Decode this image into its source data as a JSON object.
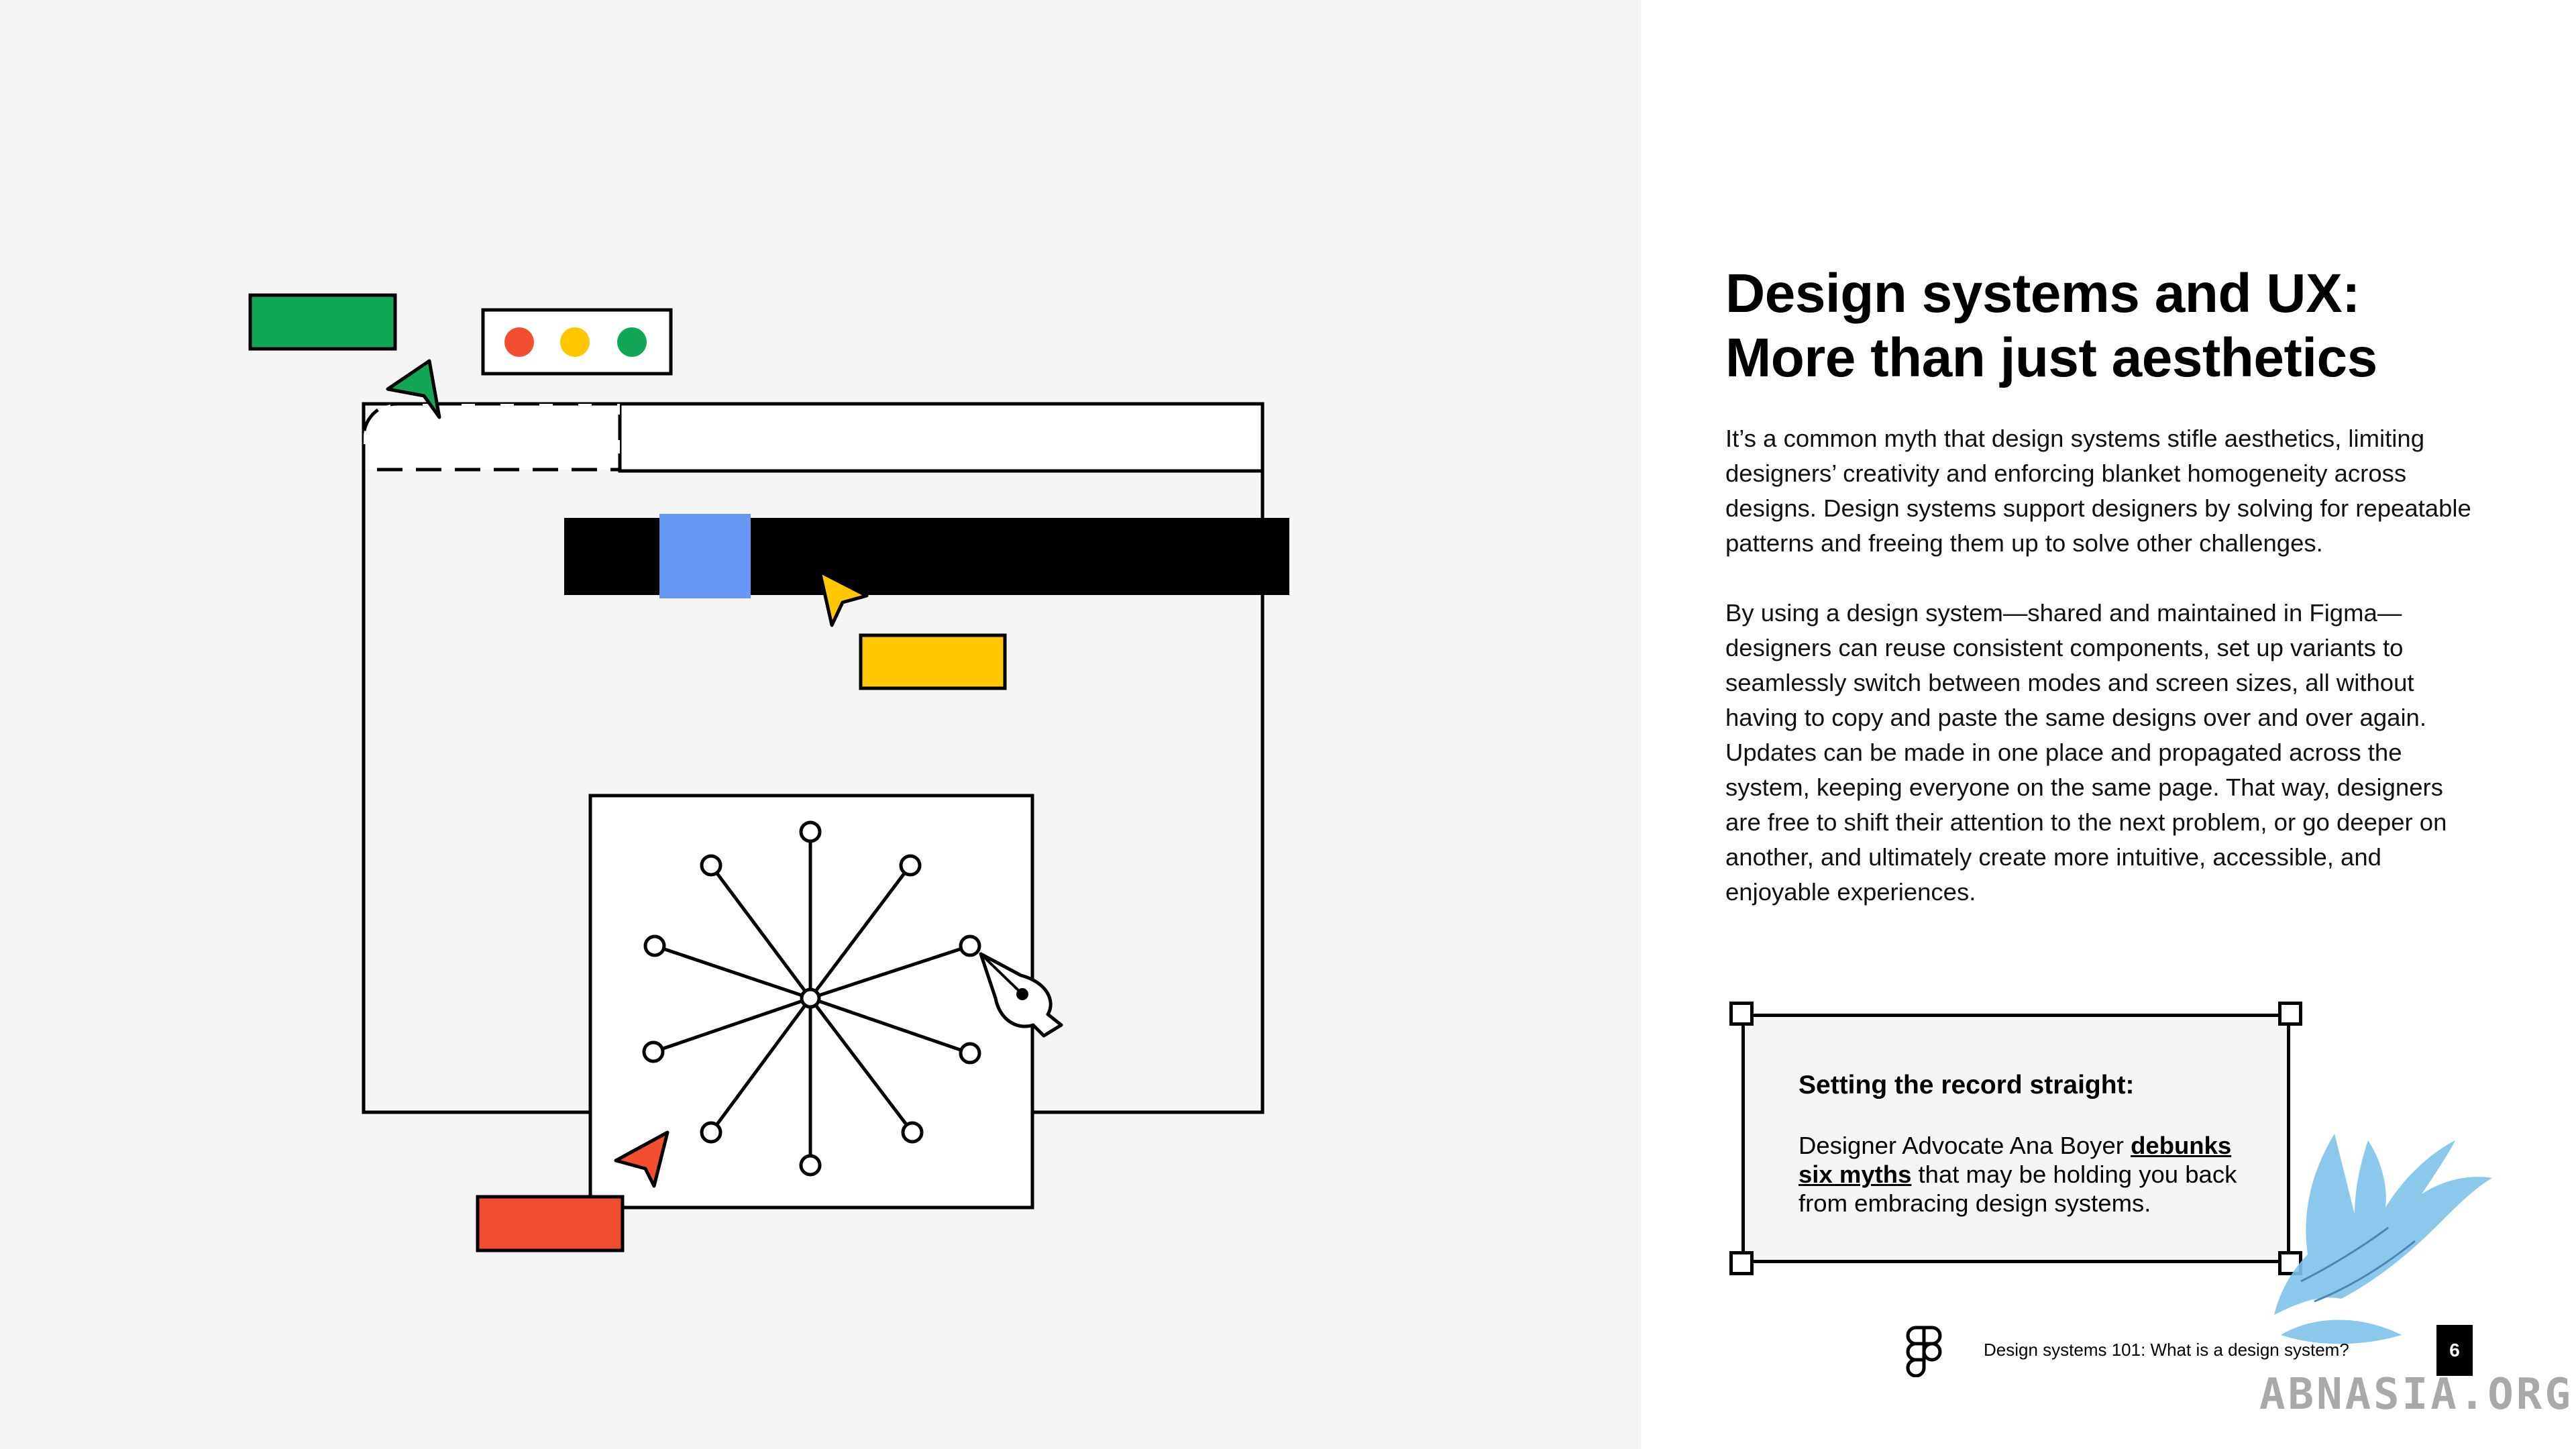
{
  "heading": {
    "line1": "Design systems and UX:",
    "line2": "More than just aesthetics"
  },
  "paragraphs": [
    "It’s a common myth that design systems stifle aesthetics, limiting designers’ creativity and enforcing blanket homogeneity across designs. Design systems support designers by solving for repeatable patterns and freeing them up to solve other challenges.",
    "By using a design system—shared and maintained in Figma—designers can reuse consistent components, set up variants to seamlessly switch between modes and screen sizes, all without having to copy and paste the same designs over and over again. Updates can be made in one place and propagated across the system, keeping everyone on the same page. That way, designers are free to shift their attention to the next problem, or go deeper on another, and ultimately create more intuitive, accessible, and enjoyable experiences."
  ],
  "callout": {
    "title": "Setting the record straight:",
    "text_before": "Designer Advocate Ana Boyer ",
    "link_text": "debunks six myths",
    "text_after": " that may be holding you back from embracing design systems."
  },
  "footer": {
    "doc_title": "Design systems 101: What is a design system?",
    "page_number": "6",
    "logo_icon": "figma-logo-icon"
  },
  "watermark": {
    "text": "ABNASIA.ORG"
  },
  "colors": {
    "left_background": "#f5f5f5",
    "green": "#12a756",
    "red": "#f24e2f",
    "yellow": "#ffc700",
    "blue": "#6699f5",
    "black": "#000000"
  }
}
